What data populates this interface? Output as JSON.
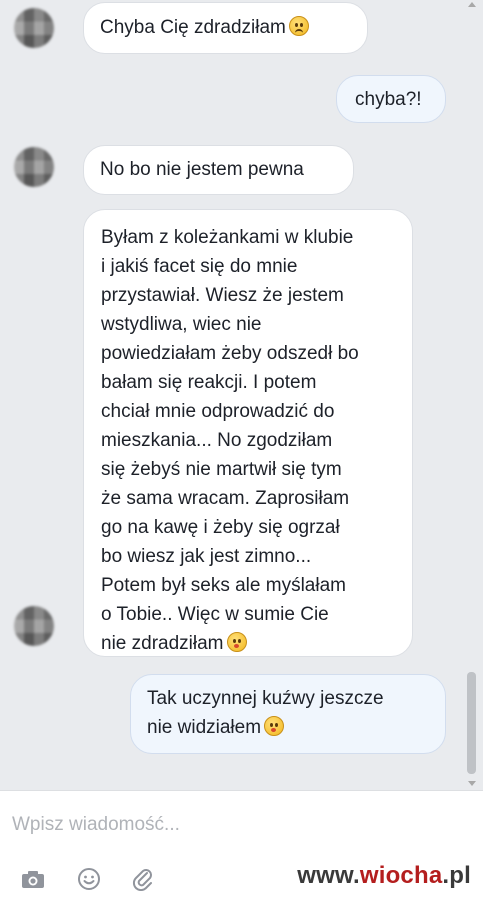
{
  "conversation": {
    "messages": [
      {
        "direction": "incoming",
        "text": "Chyba Cię zdradziłam",
        "emoji": "frowning-face"
      },
      {
        "direction": "outgoing",
        "text": "chyba?!"
      },
      {
        "direction": "incoming",
        "text": "No bo nie jestem pewna"
      },
      {
        "direction": "incoming",
        "lines": [
          "Byłam z koleżankami w klubie",
          "i jakiś facet się do mnie",
          "przystawiał. Wiesz że jestem",
          "wstydliwa, wiec nie",
          "powiedziałam żeby odszedł bo",
          "bałam się reakcji. I potem",
          "chciał mnie odprowadzić do",
          "mieszkania... No zgodziłam",
          "się żebyś nie martwił się tym",
          "że sama wracam. Zaprosiłam",
          "go na kawę i żeby się ogrzał",
          "bo wiesz jak jest zimno...",
          "Potem był seks ale myślałam",
          "o Tobie.. Więc w sumie Cie",
          "nie zdradziłam"
        ],
        "emoji": "kissing-face"
      },
      {
        "direction": "outgoing",
        "lines": [
          "Tak uczynnej kuźwy jeszcze",
          "nie widziałem"
        ],
        "emoji": "kissing-face"
      }
    ]
  },
  "composer": {
    "placeholder": "Wpisz wiadomość...",
    "tools": [
      "camera-icon",
      "smiley-icon",
      "paperclip-icon"
    ]
  },
  "watermark": {
    "prefix": "www.",
    "brand": "wiocha",
    "suffix": ".pl"
  },
  "colors": {
    "chat_background": "#e9ebee",
    "incoming_bubble": "#ffffff",
    "outgoing_bubble": "#f0f6fd",
    "watermark_red": "#b41e1e"
  }
}
